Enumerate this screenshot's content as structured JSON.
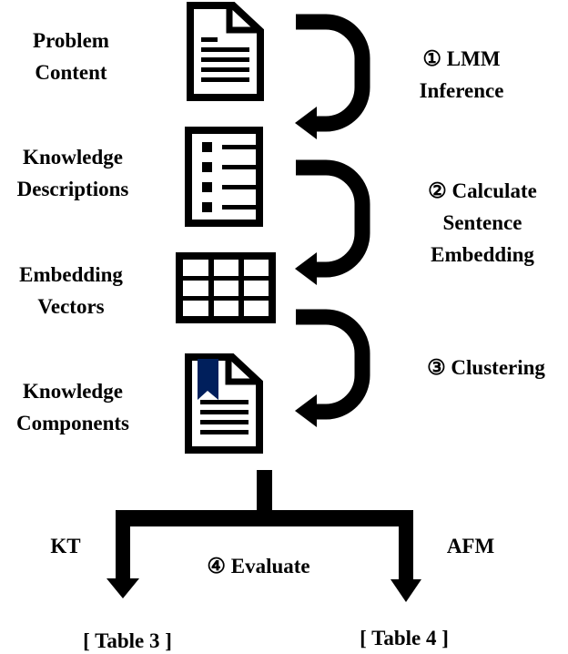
{
  "left_labels": [
    {
      "line1": "Problem",
      "line2": "Content"
    },
    {
      "line1": "Knowledge",
      "line2": "Descriptions"
    },
    {
      "line1": "Embedding",
      "line2": "Vectors"
    },
    {
      "line1": "Knowledge",
      "line2": "Components"
    }
  ],
  "steps": [
    {
      "line1": "① LMM",
      "line2": "Inference"
    },
    {
      "line1": "② Calculate",
      "line2": "Sentence",
      "line3": "Embedding"
    },
    {
      "line1": "③ Clustering"
    },
    {
      "line1": "④ Evaluate"
    }
  ],
  "branches": {
    "left_label": "KT",
    "right_label": "AFM",
    "left_target": "[ Table 3 ]",
    "right_target": "[ Table 4 ]"
  },
  "colors": {
    "ink": "#000000",
    "bookmark": "#001f5c"
  }
}
